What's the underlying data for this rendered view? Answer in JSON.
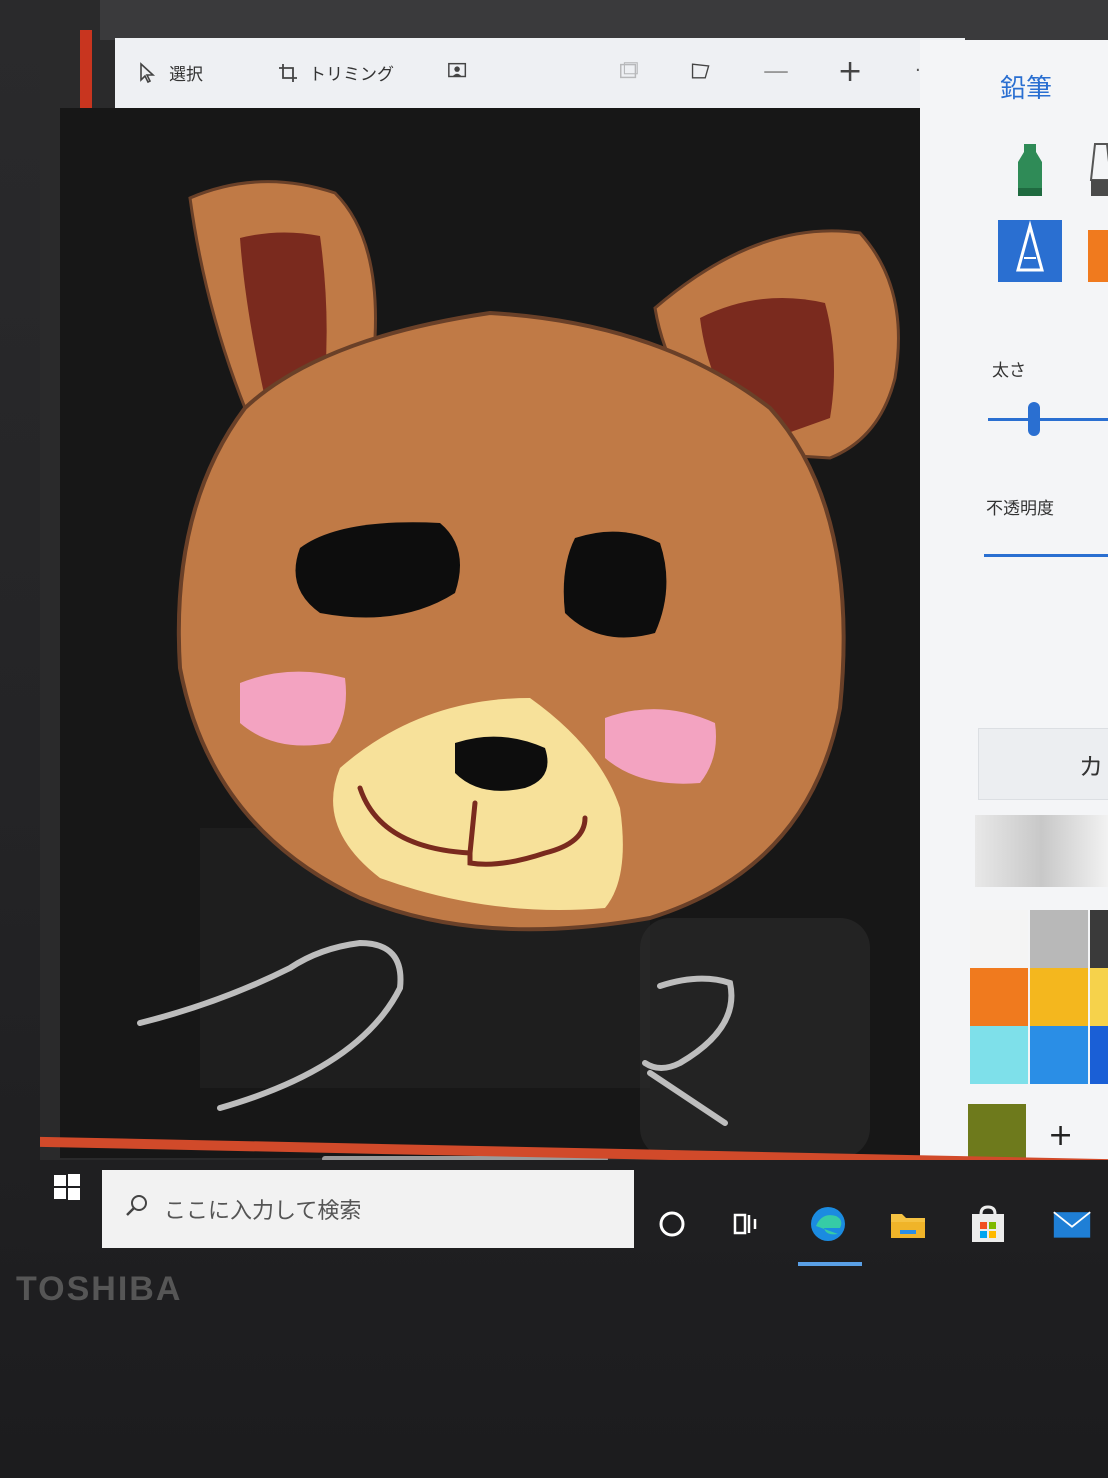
{
  "toolbar": {
    "select_label": "選択",
    "crop_label": "トリミング",
    "more_label": "···"
  },
  "side_panel": {
    "title": "鉛筆",
    "thickness_label": "太さ",
    "opacity_label": "不透明度",
    "thickness_value": 0.38,
    "opacity_value": 1.0
  },
  "taskbar": {
    "search_placeholder": "ここに入力して検索"
  },
  "device": {
    "brand": "TOSHIBA"
  },
  "palette": {
    "colors": [
      "#f4f4f4",
      "#b8b8b8",
      "#3a3a3a",
      "#f07a1e",
      "#f4b71e",
      "#f6d24b",
      "#7ee0ea",
      "#2a8ee6",
      "#1a5fd6",
      "#6e7a1c"
    ]
  },
  "canvas": {
    "bg_color": "#171717",
    "bear_brown": "#c07a46",
    "ear_inner": "#7a2a1e",
    "muzzle": "#f7e19a",
    "cheek": "#f3a3c1"
  }
}
